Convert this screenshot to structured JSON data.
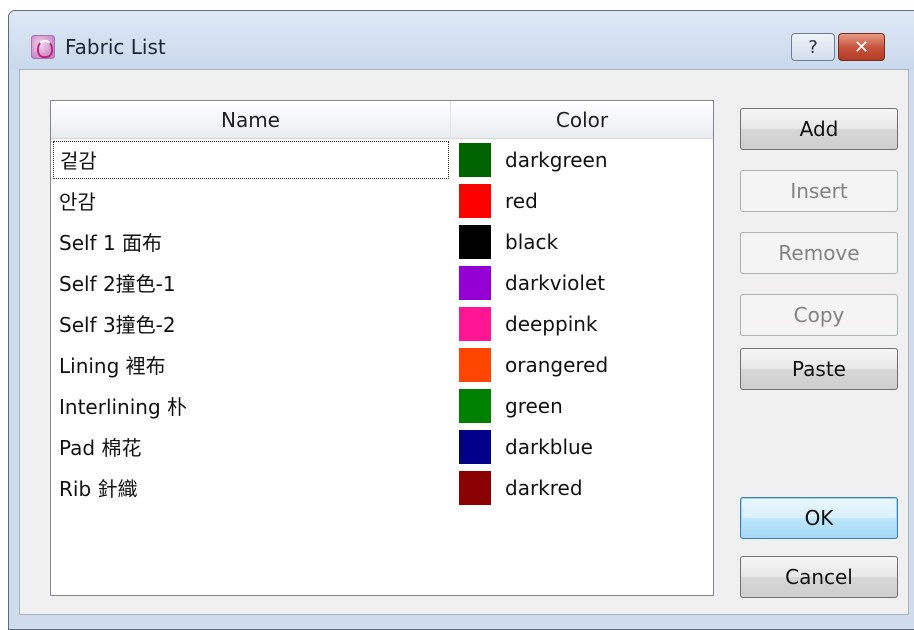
{
  "window": {
    "title": "Fabric List",
    "help_glyph": "?",
    "close_glyph": "✕"
  },
  "table": {
    "headers": {
      "name": "Name",
      "color": "Color"
    },
    "rows": [
      {
        "name": "겉감",
        "color_name": "darkgreen",
        "hex": "#006400"
      },
      {
        "name": "안감",
        "color_name": "red",
        "hex": "#ff0000"
      },
      {
        "name": "Self 1 面布",
        "color_name": "black",
        "hex": "#000000"
      },
      {
        "name": "Self 2撞色-1",
        "color_name": "darkviolet",
        "hex": "#9400d3"
      },
      {
        "name": "Self 3撞色-2",
        "color_name": "deeppink",
        "hex": "#ff1493"
      },
      {
        "name": "Lining 裡布",
        "color_name": "orangered",
        "hex": "#ff4500"
      },
      {
        "name": "Interlining 朴",
        "color_name": "green",
        "hex": "#008000"
      },
      {
        "name": "Pad 棉花",
        "color_name": "darkblue",
        "hex": "#00008b"
      },
      {
        "name": "Rib 針織",
        "color_name": "darkred",
        "hex": "#8b0000"
      }
    ],
    "focused_row": 0
  },
  "buttons": {
    "add": "Add",
    "insert": "Insert",
    "remove": "Remove",
    "copy": "Copy",
    "paste": "Paste",
    "ok": "OK",
    "cancel": "Cancel"
  },
  "states": {
    "insert_enabled": false,
    "remove_enabled": false,
    "copy_enabled": false,
    "default_button": "ok"
  },
  "icons": {
    "app": "fabric-app-icon",
    "help": "help-icon",
    "close": "close-icon"
  }
}
